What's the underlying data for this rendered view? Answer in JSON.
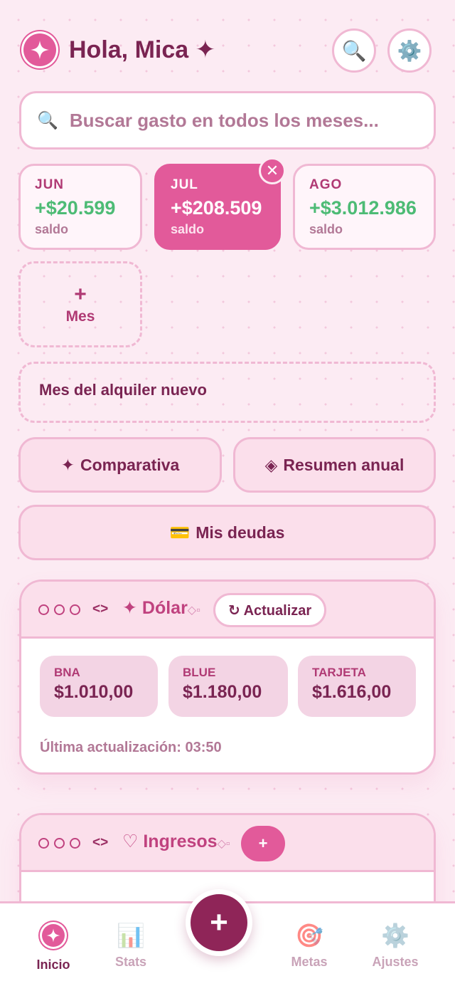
{
  "header": {
    "greeting": "Hola, Mica ✦",
    "search_icon": "🔍",
    "settings_icon": "⚙️"
  },
  "search": {
    "icon": "🔍",
    "placeholder": "Buscar gasto en todos los meses..."
  },
  "months": [
    {
      "name": "JUN",
      "value": "+$20.599",
      "sub": "saldo"
    },
    {
      "name": "JUL",
      "value": "+$208.509",
      "sub": "saldo",
      "selected": true
    },
    {
      "name": "AGO",
      "value": "+$3.012.986",
      "sub": "saldo"
    }
  ],
  "close_icon": "✕",
  "add_month": {
    "plus": "+",
    "label": "Mes"
  },
  "note": "Mes del alquiler nuevo",
  "actions": {
    "comparativa": {
      "icon": "✦",
      "label": "Comparativa"
    },
    "resumen": {
      "icon": "◈",
      "label": "Resumen anual"
    },
    "deudas": {
      "icon": "💳",
      "label": "Mis deudas"
    }
  },
  "dolar_card": {
    "code_icon": "<>",
    "title": "✦ Dólar",
    "deco": "◇▫",
    "refresh": "↻ Actualizar",
    "rates": [
      {
        "label": "BNA",
        "value": "$1.010,00"
      },
      {
        "label": "BLUE",
        "value": "$1.180,00"
      },
      {
        "label": "TARJETA",
        "value": "$1.616,00"
      }
    ],
    "updated": "Última actualización: 03:50"
  },
  "ingresos_card": {
    "code_icon": "<>",
    "title": "♡ Ingresos",
    "deco": "◇▫",
    "add": "+"
  },
  "nav": {
    "inicio": "Inicio",
    "stats": {
      "icon": "📊",
      "label": "Stats"
    },
    "fab": "+",
    "metas": {
      "icon": "🎯",
      "label": "Metas"
    },
    "ajustes": {
      "icon": "⚙️",
      "label": "Ajustes"
    }
  },
  "colors": {
    "accent": "#e25a9a",
    "primary_text": "#7a2452",
    "positive": "#4dbb75",
    "border": "#f0b8d3",
    "fab": "#8f2558"
  }
}
